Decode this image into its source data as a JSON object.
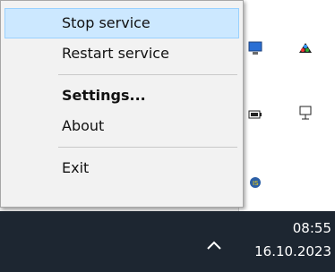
{
  "menu": {
    "items": [
      {
        "label": "Stop service",
        "highlighted": true
      },
      {
        "label": "Restart service"
      },
      {
        "label": "Settings...",
        "bold": true
      },
      {
        "label": "About"
      },
      {
        "label": "Exit"
      }
    ]
  },
  "taskbar": {
    "time": "08:55",
    "date": "16.10.2023",
    "chevron_icon": "chevron-up-icon"
  },
  "tray_icons": [
    "monitor-icon",
    "paint-icon",
    "battery-icon",
    "network-icon",
    "tray-app-icon"
  ]
}
